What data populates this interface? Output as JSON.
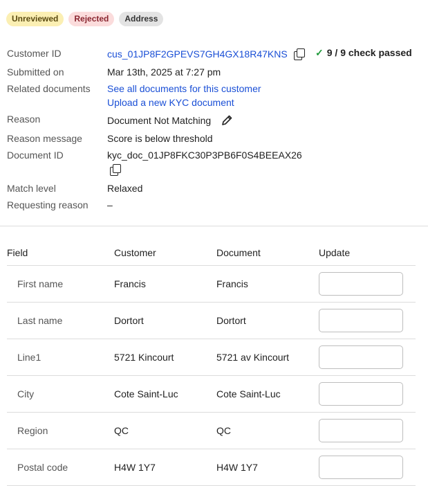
{
  "badges": {
    "unreviewed": "Unreviewed",
    "rejected": "Rejected",
    "address": "Address"
  },
  "details": {
    "customer_id_label": "Customer ID",
    "customer_id": "cus_01JP8F2GPEVS7GH4GX18R47KNS",
    "check_status": "9 / 9 check passed",
    "submitted_on_label": "Submitted on",
    "submitted_on": "Mar 13th, 2025 at 7:27 pm",
    "related_documents_label": "Related documents",
    "related_link_1": "See all documents for this customer",
    "related_link_2": "Upload a new KYC document",
    "reason_label": "Reason",
    "reason": "Document Not Matching",
    "reason_message_label": "Reason message",
    "reason_message": "Score is below threshold",
    "document_id_label": "Document ID",
    "document_id": "kyc_doc_01JP8FKC30P3PB6F0S4BEEAX26",
    "match_level_label": "Match level",
    "match_level": "Relaxed",
    "requesting_reason_label": "Requesting reason",
    "requesting_reason": "–"
  },
  "table": {
    "headers": {
      "field": "Field",
      "customer": "Customer",
      "document": "Document",
      "update": "Update"
    },
    "rows": [
      {
        "field": "First name",
        "customer": "Francis",
        "document": "Francis"
      },
      {
        "field": "Last name",
        "customer": "Dortort",
        "document": "Dortort"
      },
      {
        "field": "Line1",
        "customer": "5721 Kincourt",
        "document": "5721 av Kincourt"
      },
      {
        "field": "City",
        "customer": "Cote Saint-Luc",
        "document": "Cote Saint-Luc"
      },
      {
        "field": "Region",
        "customer": "QC",
        "document": "QC"
      },
      {
        "field": "Postal code",
        "customer": "H4W 1Y7",
        "document": "H4W 1Y7"
      }
    ]
  },
  "icons": {
    "copy": "copy-icon",
    "check": "check-icon",
    "edit": "pencil-icon"
  },
  "colors": {
    "link": "#1a4fd6",
    "check": "#1f9a3a",
    "unreviewed_bg": "#fbefb3",
    "rejected_bg": "#fbdcdc",
    "address_bg": "#e3e3e3"
  }
}
